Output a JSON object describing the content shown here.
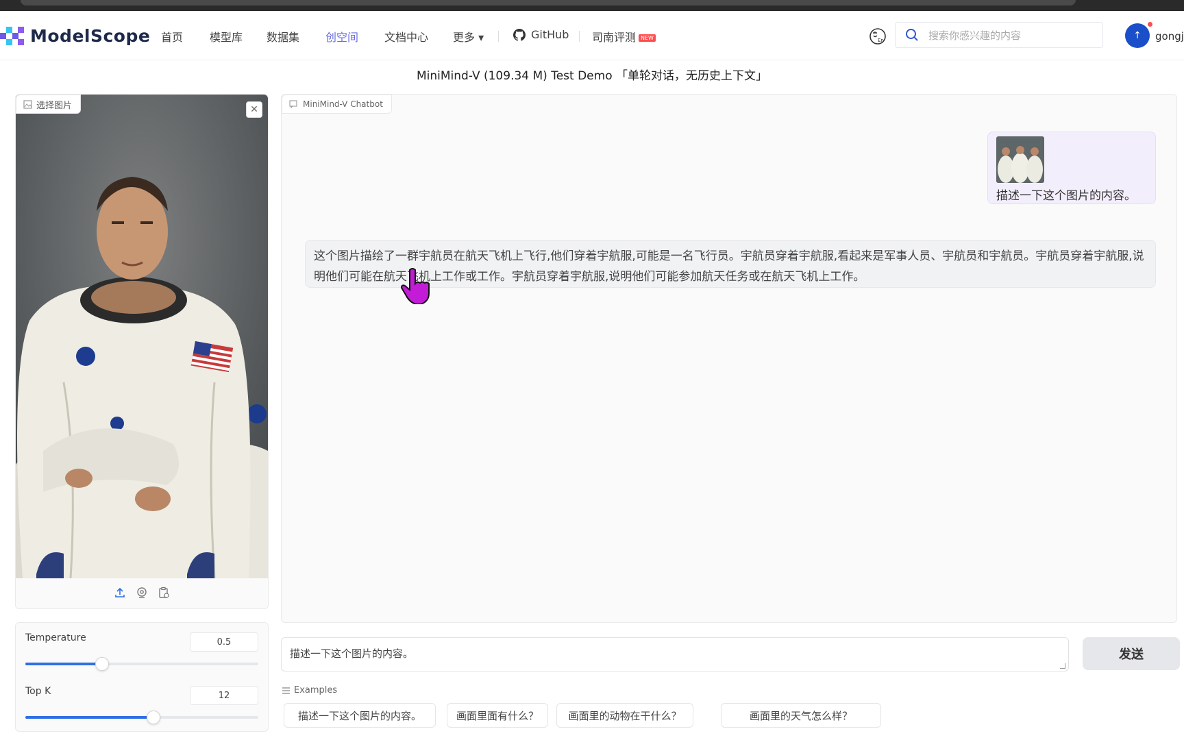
{
  "brand": {
    "name": "ModelScope"
  },
  "nav": {
    "items": [
      "首页",
      "模型库",
      "数据集",
      "创空间",
      "文档中心",
      "更多 ▾"
    ],
    "github": "GitHub",
    "eval": "司南评测",
    "new_badge": "NEW",
    "active_color": "#6b6fe0"
  },
  "search": {
    "placeholder": "搜索你感兴趣的内容"
  },
  "user": {
    "avatar_text": "↑",
    "name": "gongj"
  },
  "page": {
    "title": "MiniMind-V (109.34 M) Test Demo 「单轮对话，无历史上下文」"
  },
  "image_panel": {
    "label": "选择图片"
  },
  "params": {
    "temperature": {
      "label": "Temperature",
      "value": "0.5",
      "fraction": 0.33
    },
    "topk": {
      "label": "Top K",
      "value": "12",
      "fraction": 0.55
    }
  },
  "chat": {
    "label": "MiniMind-V Chatbot",
    "user_message": "描述一下这个图片的内容。",
    "bot_message": "这个图片描绘了一群宇航员在航天飞机上飞行,他们穿着宇航服,可能是一名飞行员。宇航员穿着宇航服,看起来是军事人员、宇航员和宇航员。宇航员穿着宇航服,说明他们可能在航天飞机上工作或工作。宇航员穿着宇航服,说明他们可能参加航天任务或在航天飞机上工作。"
  },
  "input": {
    "value": "描述一下这个图片的内容。"
  },
  "send": {
    "label": "发送"
  },
  "examples": {
    "label": "Examples",
    "items": [
      "描述一下这个图片的内容。",
      "画面里面有什么？",
      "画面里的动物在干什么？",
      "画面里的天气怎么样？"
    ]
  }
}
